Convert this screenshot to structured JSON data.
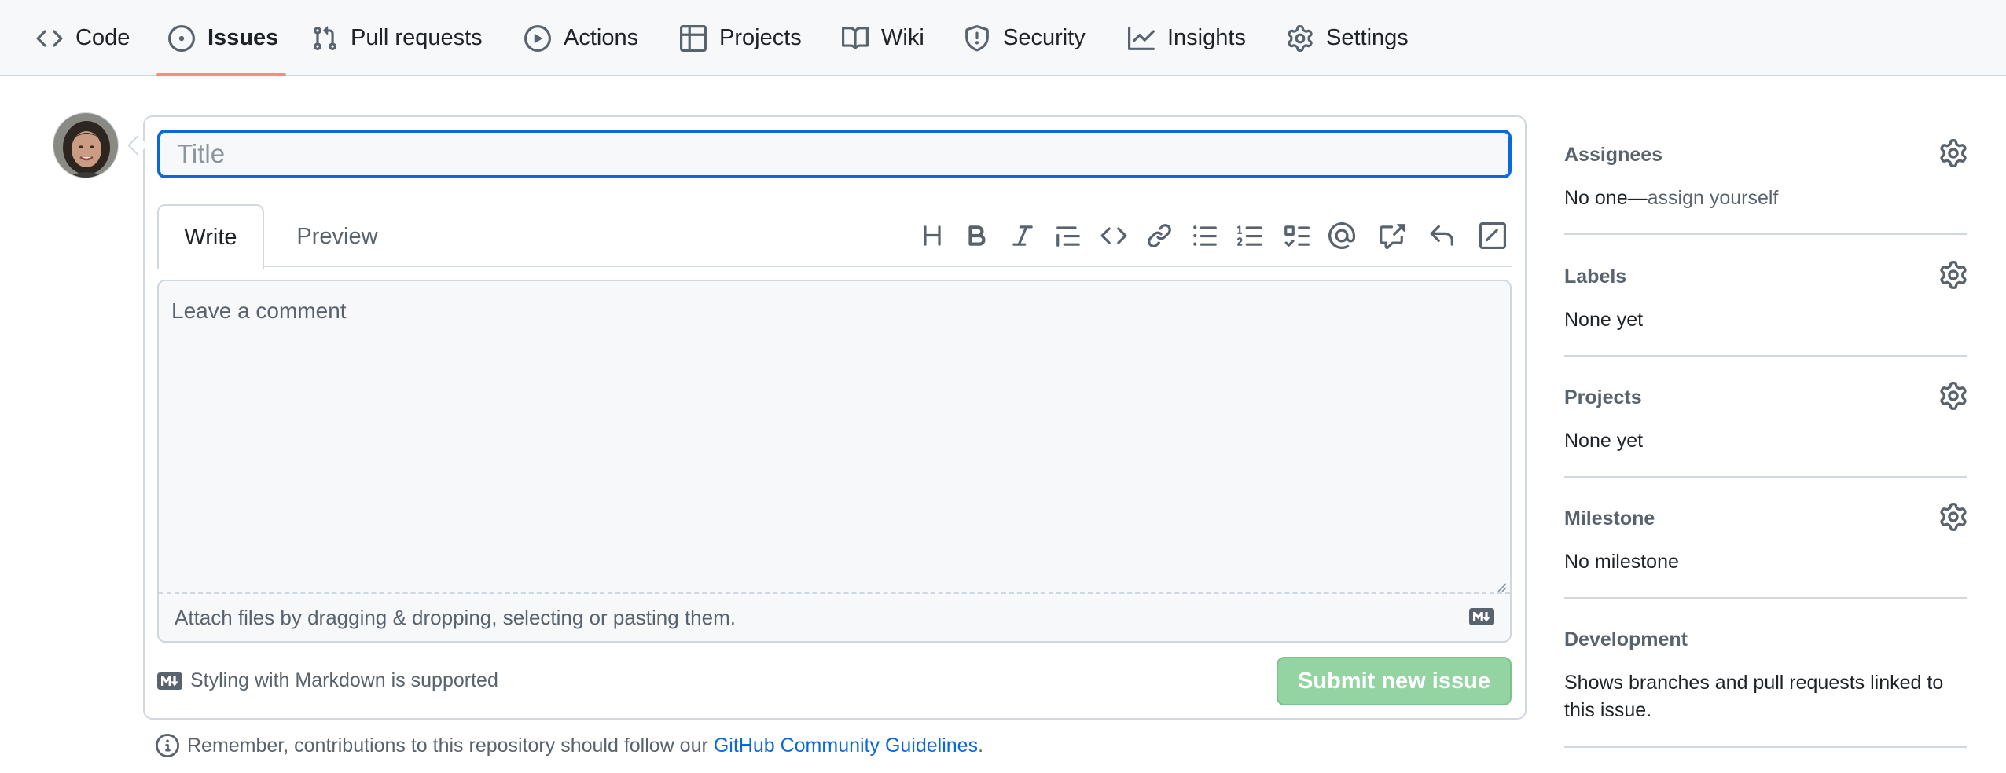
{
  "nav": {
    "tabs": [
      {
        "label": "Code",
        "icon": "code-icon"
      },
      {
        "label": "Issues",
        "icon": "issue-opened-icon",
        "selected": true
      },
      {
        "label": "Pull requests",
        "icon": "git-pull-request-icon"
      },
      {
        "label": "Actions",
        "icon": "play-icon"
      },
      {
        "label": "Projects",
        "icon": "table-icon"
      },
      {
        "label": "Wiki",
        "icon": "book-icon"
      },
      {
        "label": "Security",
        "icon": "shield-icon"
      },
      {
        "label": "Insights",
        "icon": "graph-icon"
      },
      {
        "label": "Settings",
        "icon": "gear-icon"
      }
    ],
    "accent": "#fd8c73"
  },
  "form": {
    "title_placeholder": "Title",
    "title_value": "",
    "write_tab": "Write",
    "preview_tab": "Preview",
    "toolbar": [
      "heading-icon",
      "bold-icon",
      "italic-icon",
      "quote-icon",
      "code-icon",
      "link-icon",
      "unordered-list-icon",
      "ordered-list-icon",
      "task-list-icon",
      "mention-icon",
      "cross-reference-icon",
      "saved-reply-icon",
      "slash-command-icon"
    ],
    "comment_placeholder": "Leave a comment",
    "attach_text": "Attach files by dragging & dropping, selecting or pasting them.",
    "markdown_hint": "Styling with Markdown is supported",
    "submit_label": "Submit new issue",
    "submit_color": "#94d3a2",
    "focus_color": "#0969da"
  },
  "notice": {
    "text": "Remember, contributions to this repository should follow our",
    "link": "GitHub Community Guidelines",
    "end": "."
  },
  "sidebar": {
    "assignees": {
      "title": "Assignees",
      "value": "No one—",
      "action": "assign yourself"
    },
    "labels": {
      "title": "Labels",
      "value": "None yet"
    },
    "projects": {
      "title": "Projects",
      "value": "None yet"
    },
    "milestone": {
      "title": "Milestone",
      "value": "No milestone"
    },
    "development": {
      "title": "Development",
      "value": "Shows branches and pull requests linked to this issue."
    }
  }
}
